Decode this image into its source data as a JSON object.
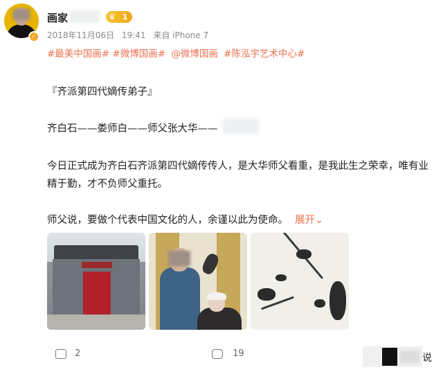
{
  "post": {
    "user_name": "画家",
    "level": "1",
    "date": "2018年11月06日",
    "time": "19:41",
    "source": "来自 iPhone 7",
    "tags": [
      "#最美中国画#",
      "#微博国画#",
      "@微博国画",
      "#陈泓宇艺术中心#"
    ],
    "title_line": "『齐派第四代嫡传弟子』",
    "lineage_line": "齐白石——娄师白——师父张大华——",
    "body_line1": "今日正式成为齐白石齐派第四代嫡传传人，是大华师父看重，是我此生之荣幸，唯有业",
    "body_line2": "精于勤，才不负师父重托。",
    "body_line3": "师父说，要做个代表中国文化的人，余谨以此为使命。",
    "expand_label": "展开",
    "expand_icon": "chevron-down-icon"
  },
  "actions": {
    "repost_count": "2",
    "comment_count": "19"
  },
  "corner_text": "说",
  "colors": {
    "link": "#eb7350",
    "meta": "#8a8a8a",
    "badge": "#f0a818"
  }
}
